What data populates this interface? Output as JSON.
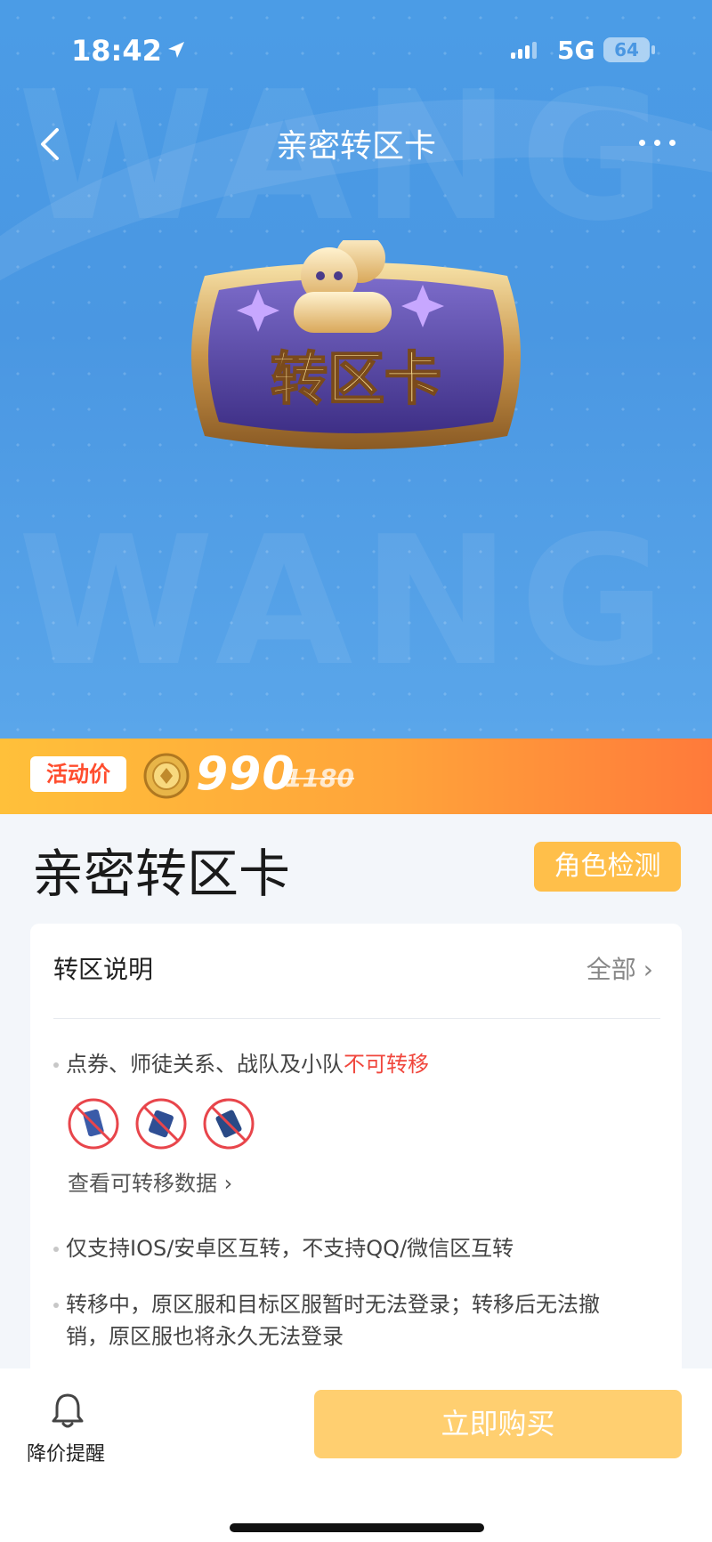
{
  "status_bar": {
    "time": "18:42",
    "network": "5G",
    "battery": "64"
  },
  "nav": {
    "title": "亲密转区卡"
  },
  "badge": {
    "text": "转区卡"
  },
  "price_banner": {
    "tag": "活动价",
    "price": "990",
    "original_price": "1180",
    "accent": "#ff7a3a"
  },
  "product": {
    "title": "亲密转区卡",
    "role_check_label": "角色检测"
  },
  "card": {
    "heading": "转区说明",
    "all_label": "全部",
    "bullet1_prefix": "点券、师徒关系、战队及小队",
    "bullet1_warn": "不可转移",
    "view_data_label": "查看可转移数据",
    "bullet2": "仅支持IOS/安卓区互转，不支持QQ/微信区互转",
    "bullet3_line1": "转移中，原区服和目标区服暂时无法登录；转移后无法撤",
    "bullet3_line2": "销，原区服也将永久无法登录"
  },
  "bottom": {
    "reminder_label": "降价提醒",
    "buy_label": "立即购买"
  },
  "icons": [
    "location-arrow-icon",
    "back-chevron-icon",
    "more-dots-icon",
    "coin-icon",
    "prohibited-item-icon",
    "bell-icon"
  ]
}
